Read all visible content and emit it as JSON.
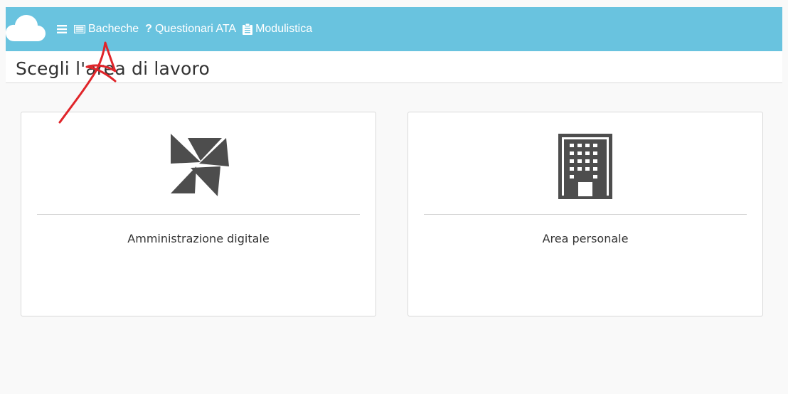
{
  "navbar": {
    "logo_icon": "cloud-icon",
    "menu_icon": "hamburger-menu-icon",
    "items": [
      {
        "label": "Bacheche",
        "icon": "newspaper-icon"
      },
      {
        "label": "Questionari ATA",
        "icon": "question-mark-icon"
      },
      {
        "label": "Modulistica",
        "icon": "clipboard-icon"
      }
    ],
    "background_color": "#69c3df"
  },
  "page": {
    "title": "Scegli l'area di lavoro"
  },
  "cards": [
    {
      "label": "Amministrazione digitale",
      "icon": "pinwheel-icon"
    },
    {
      "label": "Area personale",
      "icon": "building-icon"
    }
  ],
  "annotation": {
    "type": "red-arrow",
    "color": "#e0252a",
    "points_to": "Bacheche"
  }
}
